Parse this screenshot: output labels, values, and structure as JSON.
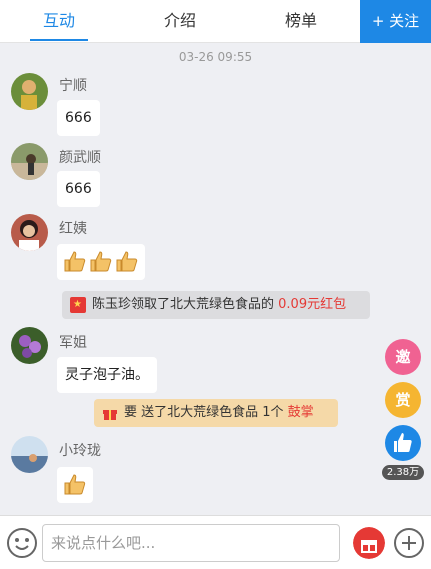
{
  "tabs": [
    {
      "label": "互动",
      "active": true
    },
    {
      "label": "介绍",
      "active": false
    },
    {
      "label": "榜单",
      "active": false
    }
  ],
  "follow_label": "+ 关注",
  "timestamp": "03-26 09:55",
  "messages": [
    {
      "name": "宁顺",
      "text": "666"
    },
    {
      "name": "颜武顺",
      "text": "666"
    },
    {
      "name": "红姨",
      "text": ""
    },
    {
      "name": "军姐",
      "text": "灵子泡子油。"
    },
    {
      "name": "小玲珑",
      "text": ""
    }
  ],
  "notices": {
    "redpacket": {
      "prefix": "陈玉珍领取了北大荒绿色食品的 ",
      "amount": "0.09元红包"
    },
    "gift": {
      "prefix": "要 送了北大荒绿色食品 1个 ",
      "item": "鼓掌"
    }
  },
  "side": {
    "invite_label": "邀",
    "reward_label": "赏",
    "likes": "2.38万"
  },
  "input": {
    "placeholder": "来说点什么吧..."
  },
  "colors": {
    "accent": "#1e88e5",
    "red": "#e53935",
    "gift_bg": "#f5d9a8"
  }
}
